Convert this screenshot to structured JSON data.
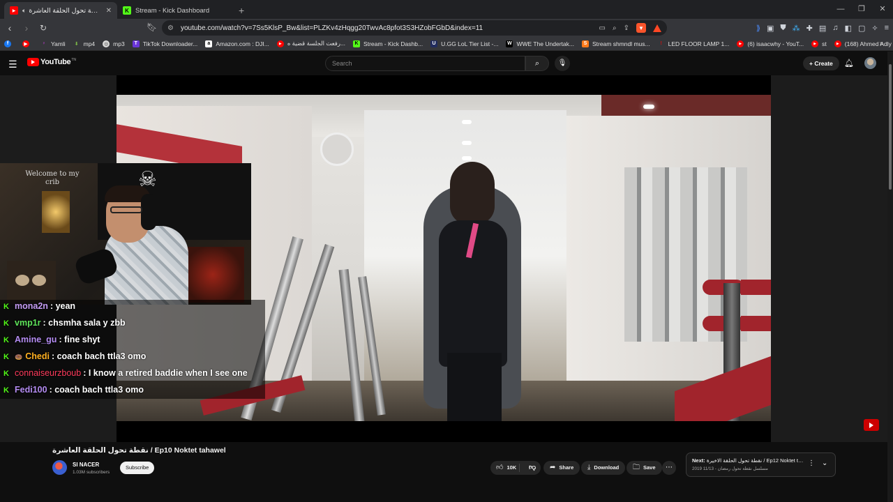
{
  "browser": {
    "tabs": [
      {
        "title": "نقطة تحول الحلقة العاشرة / Ep10",
        "active": true,
        "fav_color": "#ff0000"
      },
      {
        "title": "Stream - Kick Dashboard",
        "active": false,
        "fav_color": "#53fc18"
      }
    ],
    "new_tab_glyph": "+",
    "url": "youtube.com/watch?v=7Ss5KlsP_Bw&list=PLZKv4zHqgg20TwvAc8pfot3S3HZobFGbD&index=11",
    "bookmarks": [
      {
        "label": "",
        "color": "#1877f2",
        "glyph": "f"
      },
      {
        "label": "",
        "color": "#ff0000",
        "glyph": "▶"
      },
      {
        "label": "Yamli",
        "color": "#c43cd8",
        "glyph": "y"
      },
      {
        "label": "mp4",
        "color": "#7ab648",
        "glyph": "⬇"
      },
      {
        "label": "mp3",
        "color": "#dddddd",
        "glyph": "◎"
      },
      {
        "label": "TikTok Downloader...",
        "color": "#6a36d9",
        "glyph": "T"
      },
      {
        "label": "Amazon.com : DJI...",
        "color": "#ffffff",
        "glyph": "a"
      },
      {
        "label": "رفعت الجلسة قضية ه...",
        "color": "#ff0000",
        "glyph": "▶"
      },
      {
        "label": "Stream - Kick Dashb...",
        "color": "#53fc18",
        "glyph": "K"
      },
      {
        "label": "U.GG LoL Tier List -...",
        "color": "#222c5e",
        "glyph": "U"
      },
      {
        "label": "WWE The Undertak...",
        "color": "#000000",
        "glyph": "W"
      },
      {
        "label": "Stream shmndl mus...",
        "color": "#ff7a1a",
        "glyph": "S"
      },
      {
        "label": "LED FLOOR LAMP 1...",
        "color": "#d01010",
        "glyph": "!"
      },
      {
        "label": "(6) isaacwhy - YouT...",
        "color": "#ff0000",
        "glyph": "▶"
      },
      {
        "label": "st",
        "color": "#ff0000",
        "glyph": "▶"
      },
      {
        "label": "(168) Ahmed Adly |...",
        "color": "#ff0000",
        "glyph": "▶"
      }
    ]
  },
  "youtube": {
    "logo_text": "YouTube",
    "logo_tm": "TN",
    "search_placeholder": "Search",
    "create_label": "Create"
  },
  "webcam": {
    "sign_text": "Welcome to my crib"
  },
  "chat": [
    {
      "user": "mona2n",
      "color": "#c59cf5",
      "message": ": yean"
    },
    {
      "user": "vmp1r",
      "color": "#5ee35a",
      "message": ": chsmha sala y zbb"
    },
    {
      "user": "Amine_gu",
      "color": "#b48cf2",
      "message": ": fine shyt"
    },
    {
      "user": "Chedi",
      "color": "#ffb020",
      "message": ": coach bach ttla3 omo",
      "badge": "🍩"
    },
    {
      "user": "connaiseurzboub",
      "color": "#ff3b5c",
      "message": ": I know a retired baddie when I see one"
    },
    {
      "user": "Fedi100",
      "color": "#b48cf2",
      "message": ": coach bach ttla3 omo"
    }
  ],
  "video": {
    "title": "نقطة تحول الحلقة العاشرة / Ep10 Noktet tahawel",
    "channel": "SI NACER",
    "subscribers": "1.03M subscribers",
    "subscribe_label": "Subscribe",
    "likes": "10K",
    "share_label": "Share",
    "download_label": "Download",
    "save_label": "Save"
  },
  "next": {
    "prefix": "Next:",
    "title": "نقطة تحول الحلقة الاخيرة / Ep12 Noktet tahaw...",
    "meta": "2019 مسلسل نقطة تحول رمضان - 11/13"
  },
  "colors": {
    "youtube_red": "#ff0000",
    "kick_green": "#53fc18",
    "page_bg": "#0f0f0f"
  }
}
